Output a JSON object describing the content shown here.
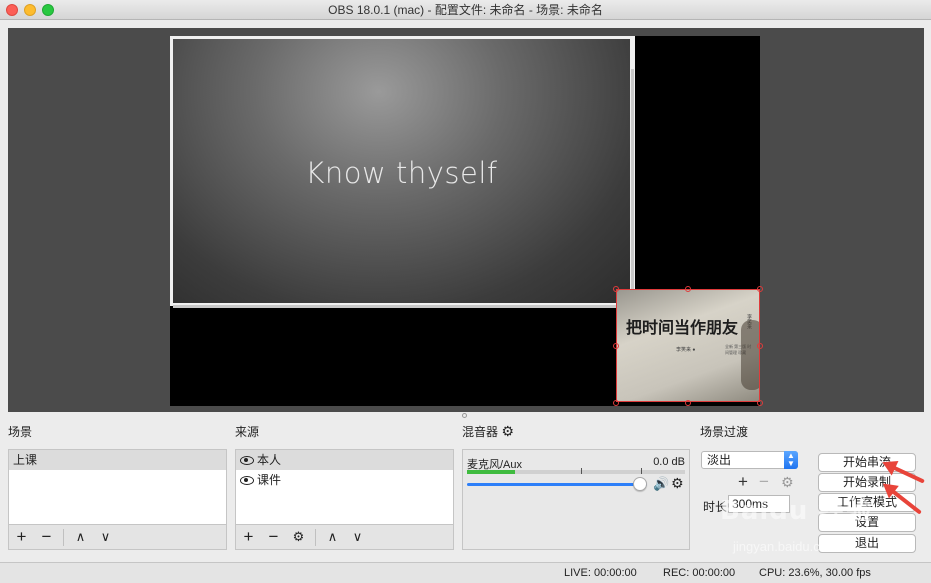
{
  "window": {
    "title": "OBS 18.0.1 (mac) - 配置文件: 未命名 - 场景: 未命名"
  },
  "preview": {
    "slide_text": "Know thyself",
    "camera_book_title": "把时间当作朋友",
    "camera_book_tag": "李笑来",
    "camera_small_text": "李笑来 ●",
    "camera_small_text2": "全新 第三版 时间管理 珍藏"
  },
  "scenes": {
    "title": "场景",
    "items": [
      "上课"
    ]
  },
  "sources": {
    "title": "来源",
    "items": [
      "本人",
      "课件"
    ]
  },
  "mixer": {
    "title": "混音器",
    "channel_name": "麦克风/Aux",
    "db": "0.0 dB",
    "volume_level": 0.96,
    "meter_level": 0.22
  },
  "transitions": {
    "title": "场景过渡",
    "selected": "淡出",
    "duration_label": "时长",
    "duration_value": "300ms"
  },
  "controls": {
    "start_streaming": "开始串流",
    "start_recording": "开始录制",
    "studio_mode": "工作室模式",
    "settings": "设置",
    "exit": "退出"
  },
  "watermark": {
    "logo": "Baidu 经验",
    "url": "jingyan.baidu.com"
  },
  "status": {
    "live": "LIVE: 00:00:00",
    "rec": "REC: 00:00:00",
    "cpu": "CPU: 23.6%, 30.00 fps"
  }
}
